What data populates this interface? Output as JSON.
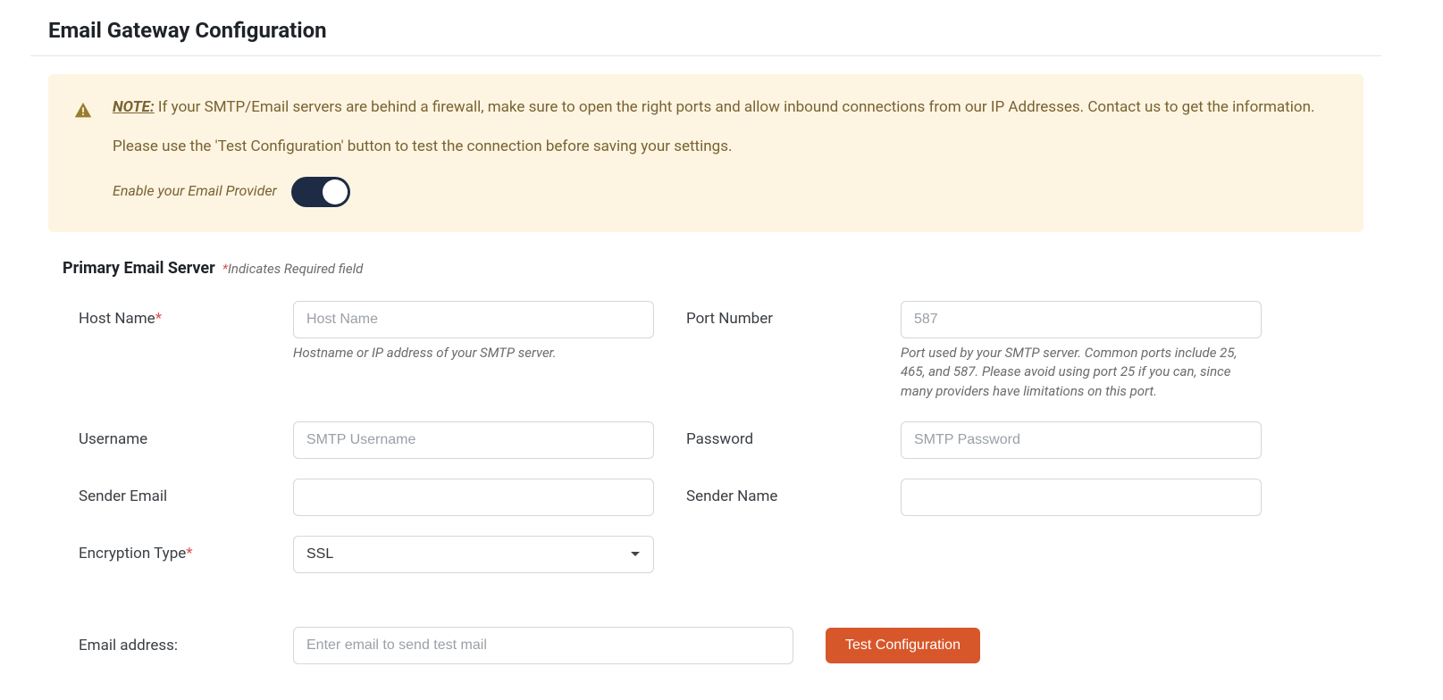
{
  "page": {
    "title": "Email Gateway Configuration"
  },
  "alert": {
    "note_label": "NOTE:",
    "note_text": " If your SMTP/Email servers are behind a firewall, make sure to open the right ports and allow inbound connections from our IP Addresses. Contact us to get the information.",
    "test_text": "Please use the 'Test Configuration' button to test the connection before saving your settings.",
    "toggle_label": "Enable your Email Provider"
  },
  "section": {
    "heading": "Primary Email Server",
    "required_note": "Indicates Required field"
  },
  "fields": {
    "host_name": {
      "label": "Host Name",
      "placeholder": "Host Name",
      "helper": "Hostname or IP address of your SMTP server."
    },
    "port_number": {
      "label": "Port Number",
      "placeholder": "587",
      "helper": "Port used by your SMTP server. Common ports include 25, 465, and 587. Please avoid using port 25 if you can, since many providers have limitations on this port."
    },
    "username": {
      "label": "Username",
      "placeholder": "SMTP Username"
    },
    "password": {
      "label": "Password",
      "placeholder": "SMTP Password"
    },
    "sender_email": {
      "label": "Sender Email"
    },
    "sender_name": {
      "label": "Sender Name"
    },
    "encryption_type": {
      "label": "Encryption Type",
      "value": "SSL"
    }
  },
  "test": {
    "label": "Email address:",
    "placeholder": "Enter email to send test mail",
    "button": "Test Configuration"
  }
}
